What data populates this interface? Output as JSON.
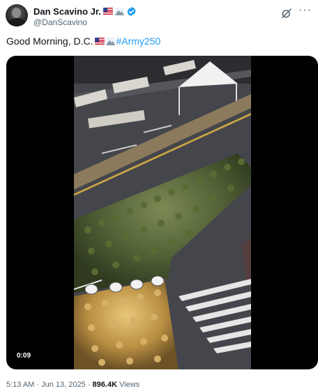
{
  "tweet": {
    "author": {
      "display_name": "Dan Scavino Jr.",
      "handle": "@DanScavino",
      "badges": [
        "us-flag-icon",
        "mountain-icon",
        "verified-badge-icon"
      ]
    },
    "text": {
      "body": "Good Morning, D.C.",
      "emojis": [
        "us-flag-icon",
        "mountain-icon"
      ],
      "hashtag": "#Army250"
    },
    "media": {
      "type": "video",
      "duration": "0:09"
    },
    "meta": {
      "time": "5:13 AM",
      "separator": " · ",
      "date": "Jun 13, 2025",
      "views_count": "896.4K",
      "views_label": "Views"
    },
    "header_actions": [
      "grok-icon",
      "more-options-icon"
    ]
  },
  "colors": {
    "text": "#0f1419",
    "secondary_text": "#536471",
    "link": "#1d9bf0",
    "verified": "#1d9bf0",
    "media_background": "#000000"
  }
}
